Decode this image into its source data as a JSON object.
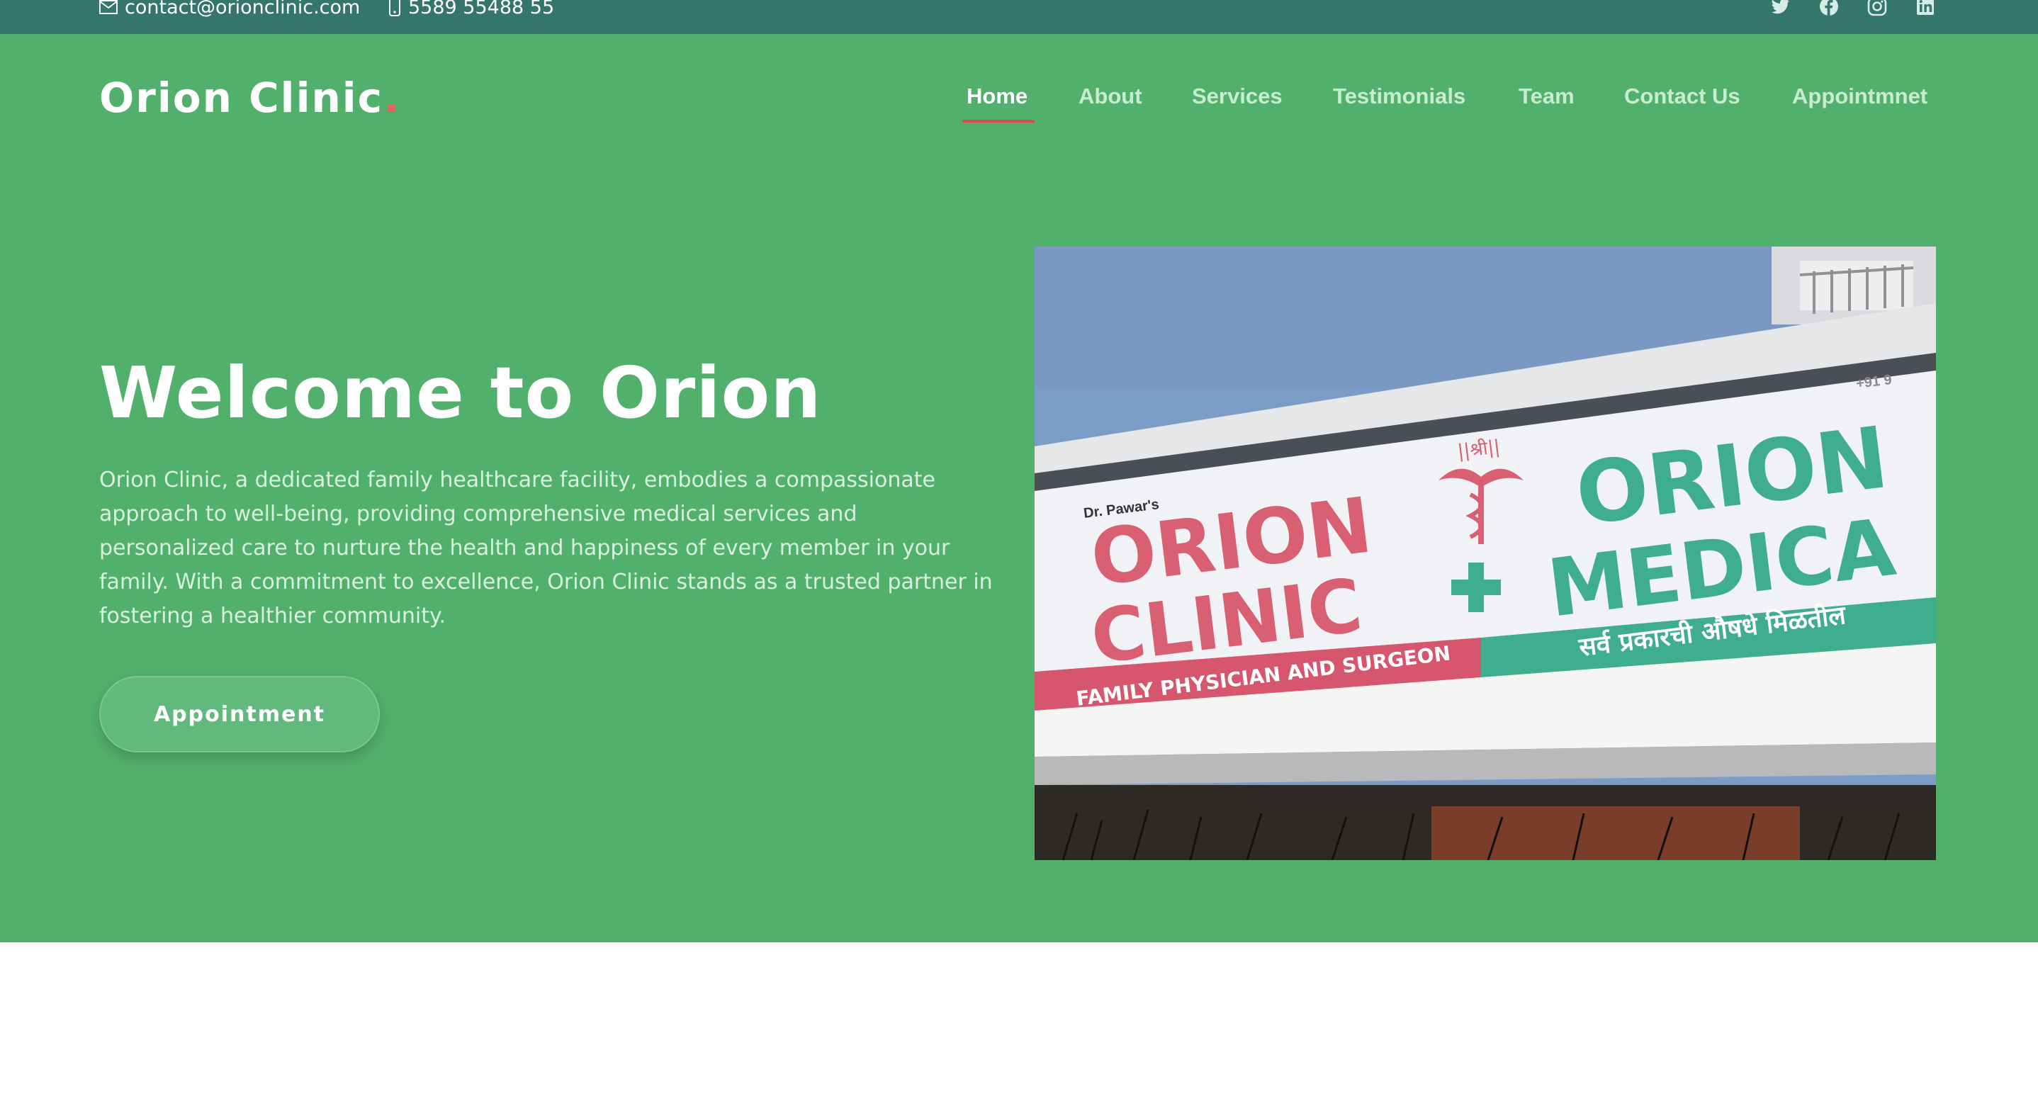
{
  "topbar": {
    "email": "contact@orionclinic.com",
    "phone": "5589 55488 55",
    "email_icon": "envelope-icon",
    "phone_icon": "phone-icon",
    "socials": [
      "twitter-icon",
      "facebook-icon",
      "instagram-icon",
      "linkedin-icon"
    ]
  },
  "header": {
    "logo_text": "Orion Clinic",
    "logo_dot": ".",
    "nav": [
      {
        "label": "Home",
        "active": true
      },
      {
        "label": "About",
        "active": false
      },
      {
        "label": "Services",
        "active": false
      },
      {
        "label": "Testimonials",
        "active": false
      },
      {
        "label": "Team",
        "active": false
      },
      {
        "label": "Contact Us",
        "active": false
      },
      {
        "label": "Appointmnet",
        "active": false
      }
    ]
  },
  "hero": {
    "title": "Welcome to Orion",
    "description": "Orion Clinic, a dedicated family healthcare facility, embodies a compassionate approach to well-being, providing comprehensive medical services and personalized care to nurture the health and happiness of every member in your family. With a commitment to excellence, Orion Clinic stands as a trusted partner in fostering a healthier community.",
    "button_label": "Appointment",
    "image": {
      "sign_small_label": "Dr. Pawar's",
      "sign_line1": "ORION",
      "sign_line2": "CLINIC",
      "sign_tagline": "FAMILY PHYSICIAN AND SURGEON",
      "sign_right_line1": "ORION",
      "sign_right_line2": "MEDICA",
      "sign_devanagari_top": "||श्री||",
      "sign_devanagari_strip": "सर्व प्रकारची औषधे मिळतील",
      "sign_phone_fragment": "+91 9"
    }
  },
  "colors": {
    "topbar": "#35766b",
    "hero_bg": "#52b06d",
    "accent_red": "#e0484e",
    "nav_inactive": "#c9ebd2"
  }
}
